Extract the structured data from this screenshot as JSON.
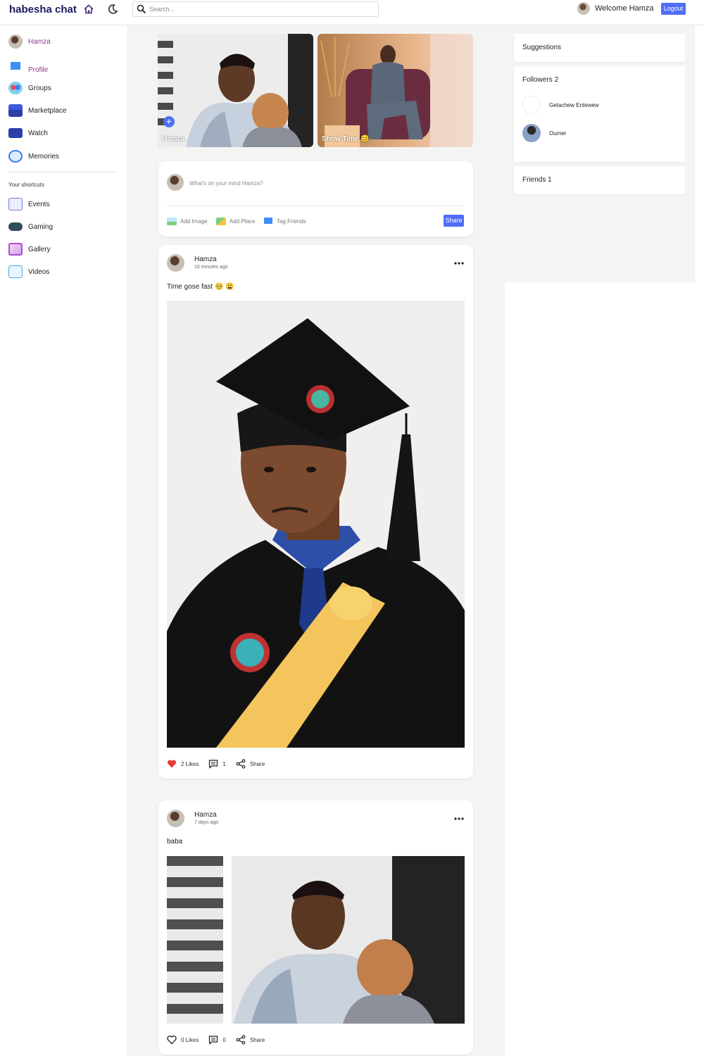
{
  "header": {
    "logo": "habesha chat",
    "home_icon": "home-icon",
    "theme_icon": "moon-icon",
    "search_placeholder": "Search...",
    "welcome_text": "Welcome Hamza",
    "logout_label": "Logout"
  },
  "sidebar": {
    "items": [
      {
        "label": "Hamza",
        "icon": "user-avatar",
        "color": "#8e3b8f"
      },
      {
        "label": "Profile",
        "icon": "profile-icon",
        "color": "#8e3b8f"
      },
      {
        "label": "Groups",
        "icon": "groups-icon"
      },
      {
        "label": "Marketplace",
        "icon": "marketplace-icon"
      },
      {
        "label": "Watch",
        "icon": "watch-icon"
      },
      {
        "label": "Memories",
        "icon": "memories-icon"
      }
    ],
    "shortcuts_title": "Your shortcuts",
    "shortcuts": [
      {
        "label": "Events",
        "icon": "events-icon"
      },
      {
        "label": "Gaming",
        "icon": "gaming-icon"
      },
      {
        "label": "Gallery",
        "icon": "gallery-icon"
      },
      {
        "label": "Videos",
        "icon": "videos-icon"
      }
    ]
  },
  "stories": [
    {
      "name": "Hamza",
      "has_add": true
    },
    {
      "name": "Show Time 😊",
      "has_add": false
    }
  ],
  "composer": {
    "placeholder": "What's on your mind Hamza?",
    "actions": [
      "Add Image",
      "Add Place",
      "Tag Friends"
    ],
    "share_label": "Share"
  },
  "posts": [
    {
      "author": "Hamza",
      "time": "10 minutes ago",
      "text": "Time gose fast 🥺 😩",
      "likes": "2 Likes",
      "liked": true,
      "comments": "1",
      "share": "Share"
    },
    {
      "author": "Hamza",
      "time": "7 days ago",
      "text": "baba",
      "likes": "0 Likes",
      "liked": false,
      "comments": "0",
      "share": "Share"
    }
  ],
  "right": {
    "suggestions_title": "Suggestions",
    "followers_title": "Followers 2",
    "followers": [
      {
        "name": "Getachew Entewew"
      },
      {
        "name": "Oumer"
      }
    ],
    "friends_title": "Friends 1"
  },
  "colors": {
    "brand": "#1c1a5e",
    "accent": "#4f6ef7",
    "like": "#e0245e",
    "background": "#f4f4f3"
  }
}
